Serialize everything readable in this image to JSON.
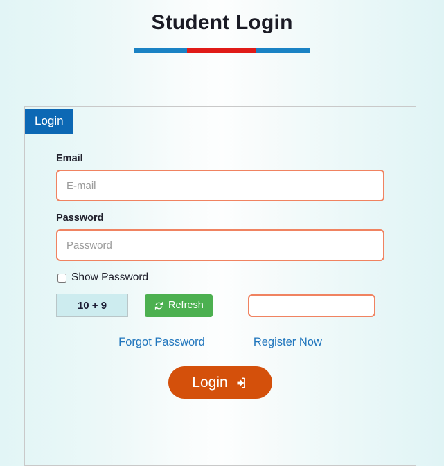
{
  "header": {
    "title": "Student Login",
    "rule_colors": {
      "left": "#1a82c4",
      "center": "#e01b18",
      "right": "#1a82c4"
    }
  },
  "card": {
    "tab_label": "Login",
    "tab_color": "#0c68b4",
    "border_color": "#c9c9c9"
  },
  "form": {
    "email": {
      "label": "Email",
      "placeholder": "E-mail",
      "value": ""
    },
    "password": {
      "label": "Password",
      "placeholder": "Password",
      "value": ""
    },
    "show_password": {
      "label": "Show Password",
      "checked": false
    },
    "captcha": {
      "question": "10 + 9",
      "refresh_label": "Refresh",
      "refresh_icon": "refresh-icon",
      "refresh_color": "#4cb050",
      "answer_value": "",
      "answer_placeholder": "",
      "box_color": "#cdecef"
    },
    "links": {
      "forgot_password": "Forgot Password",
      "register_now": "Register Now",
      "link_color": "#2176bd"
    },
    "submit": {
      "label": "Login",
      "icon": "sign-in-icon",
      "color": "#d4500b"
    }
  },
  "theme": {
    "input_border": "#f08361",
    "background_edge": "#e2f5f6",
    "background_center": "#fdfefe"
  }
}
